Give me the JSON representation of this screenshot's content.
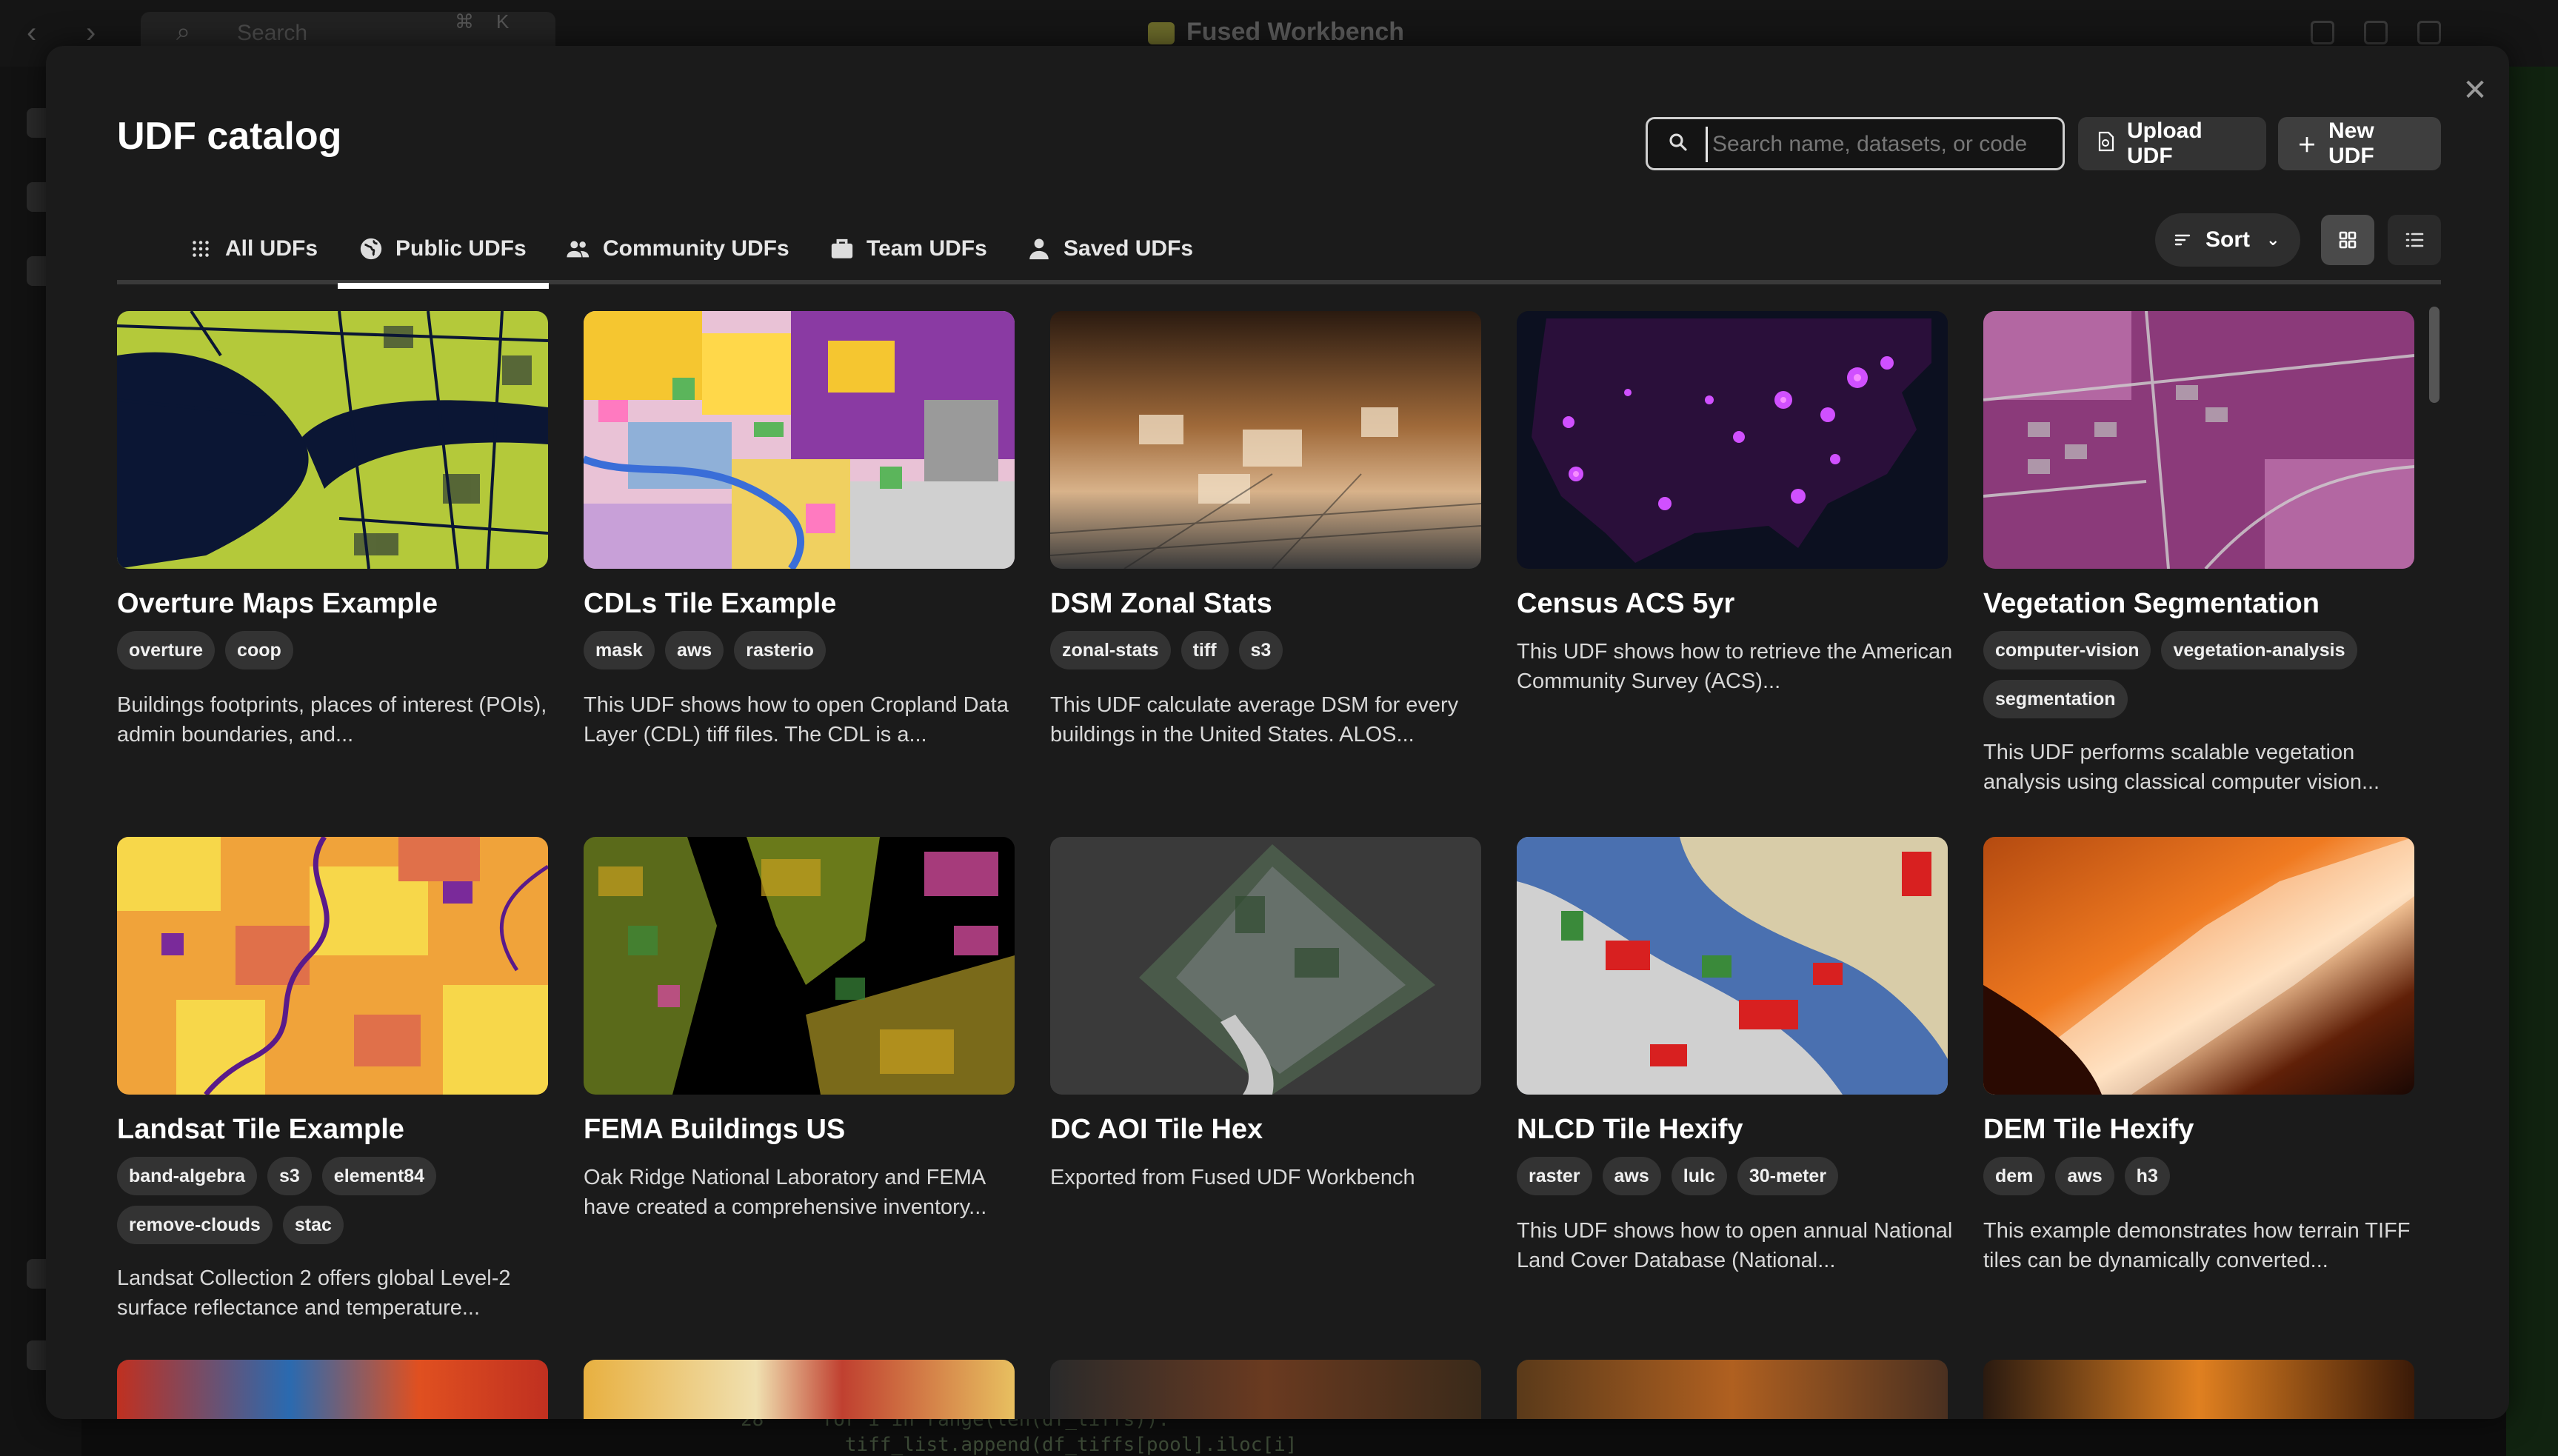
{
  "background": {
    "app_title": "Fused Workbench",
    "search_placeholder": "Search",
    "search_kbd_1": "⌘",
    "search_kbd_2": "K",
    "code_line_1": "for i in range(len(df_tiffs)):",
    "code_line_2": "tiff_list.append(df_tiffs[pool].iloc[i]",
    "code_line_no": "28"
  },
  "modal": {
    "title": "UDF catalog",
    "search_placeholder": "Search name, datasets, or code",
    "upload_label": "Upload UDF",
    "new_label": "New UDF",
    "sort_label": "Sort",
    "tabs": [
      {
        "label": "All UDFs",
        "icon": "grid-dots-icon"
      },
      {
        "label": "Public UDFs",
        "icon": "globe-icon",
        "active": true
      },
      {
        "label": "Community UDFs",
        "icon": "people-icon"
      },
      {
        "label": "Team UDFs",
        "icon": "briefcase-icon"
      },
      {
        "label": "Saved UDFs",
        "icon": "person-icon"
      }
    ]
  },
  "cards": [
    {
      "title": "Overture Maps Example",
      "tags": [
        "overture",
        "coop"
      ],
      "desc": "Buildings footprints, places of interest (POIs), admin boundaries, and..."
    },
    {
      "title": "CDLs Tile Example",
      "tags": [
        "mask",
        "aws",
        "rasterio"
      ],
      "desc": "This UDF shows how to open Cropland Data Layer (CDL) tiff files. The CDL is a..."
    },
    {
      "title": "DSM Zonal Stats",
      "tags": [
        "zonal-stats",
        "tiff",
        "s3"
      ],
      "desc": "This UDF calculate average DSM for every buildings in the United States. ALOS..."
    },
    {
      "title": "Census ACS 5yr",
      "tags": [],
      "desc": "This UDF shows how to retrieve the American Community Survey (ACS)..."
    },
    {
      "title": "Vegetation Segmentation",
      "tags": [
        "computer-vision",
        "vegetation-analysis",
        "segmentation"
      ],
      "desc": "This UDF performs scalable vegetation analysis using classical computer vision..."
    },
    {
      "title": "Landsat Tile Example",
      "tags": [
        "band-algebra",
        "s3",
        "element84",
        "remove-clouds",
        "stac"
      ],
      "desc": "Landsat Collection 2 offers global Level-2 surface reflectance and temperature..."
    },
    {
      "title": "FEMA Buildings US",
      "tags": [],
      "desc": "Oak Ridge National Laboratory and FEMA have created a comprehensive inventory..."
    },
    {
      "title": "DC AOI Tile Hex",
      "tags": [],
      "desc": "Exported from Fused UDF Workbench"
    },
    {
      "title": "NLCD Tile Hexify",
      "tags": [
        "raster",
        "aws",
        "lulc",
        "30-meter"
      ],
      "desc": "This UDF shows how to open annual National Land Cover Database (National..."
    },
    {
      "title": "DEM Tile Hexify",
      "tags": [
        "dem",
        "aws",
        "h3"
      ],
      "desc": "This example demonstrates how terrain TIFF tiles can be dynamically converted..."
    }
  ]
}
